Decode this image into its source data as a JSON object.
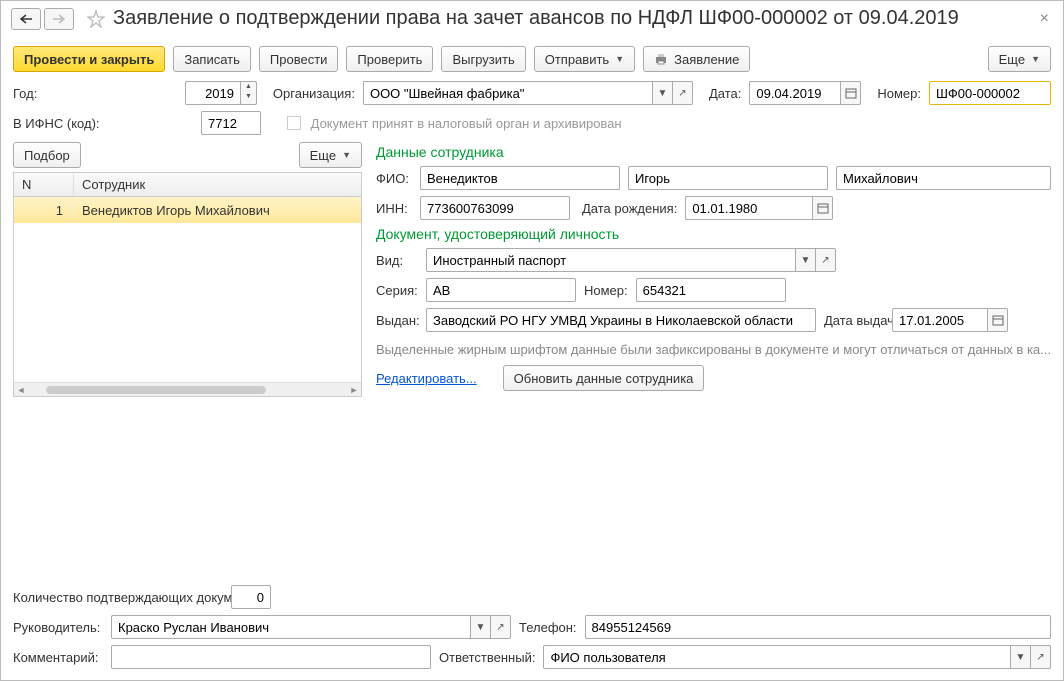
{
  "title": "Заявление о подтверждении права на зачет авансов по НДФЛ ШФ00-000002 от 09.04.2019",
  "toolbar": {
    "post_close": "Провести и закрыть",
    "save": "Записать",
    "post": "Провести",
    "check": "Проверить",
    "export": "Выгрузить",
    "send": "Отправить",
    "print": "Заявление",
    "more": "Еще"
  },
  "header": {
    "year_label": "Год:",
    "year": "2019",
    "org_label": "Организация:",
    "org": "ООО \"Швейная фабрика\"",
    "date_label": "Дата:",
    "date": "09.04.2019",
    "number_label": "Номер:",
    "number": "ШФ00-000002",
    "ifns_label": "В ИФНС (код):",
    "ifns": "7712",
    "archived_label": "Документ принят в налоговый орган и архивирован"
  },
  "left": {
    "select_btn": "Подбор",
    "more": "Еще",
    "col_n": "N",
    "col_emp": "Сотрудник",
    "rows": [
      {
        "n": "1",
        "name": "Венедиктов Игорь Михайлович"
      }
    ]
  },
  "emp": {
    "section1": "Данные сотрудника",
    "fio_label": "ФИО:",
    "surname": "Венедиктов",
    "name": "Игорь",
    "patronymic": "Михайлович",
    "inn_label": "ИНН:",
    "inn": "773600763099",
    "birth_label": "Дата рождения:",
    "birth": "01.01.1980",
    "section2": "Документ, удостоверяющий личность",
    "kind_label": "Вид:",
    "kind": "Иностранный паспорт",
    "series_label": "Серия:",
    "series": "АВ",
    "docnum_label": "Номер:",
    "docnum": "654321",
    "issued_label": "Выдан:",
    "issued": "Заводский РО НГУ УМВД Украины в Николаевской области",
    "issue_date_label": "Дата выдачи:",
    "issue_date": "17.01.2005",
    "note": "Выделенные жирным шрифтом данные были зафиксированы в документе и могут отличаться от данных в ка...",
    "edit_link": "Редактировать...",
    "refresh_btn": "Обновить данные сотрудника"
  },
  "footer": {
    "docs_count_label": "Количество подтверждающих документов:",
    "docs_count": "0",
    "manager_label": "Руководитель:",
    "manager": "Краско Руслан Иванович",
    "phone_label": "Телефон:",
    "phone": "84955124569",
    "comment_label": "Комментарий:",
    "comment": "",
    "responsible_label": "Ответственный:",
    "responsible": "ФИО пользователя"
  }
}
